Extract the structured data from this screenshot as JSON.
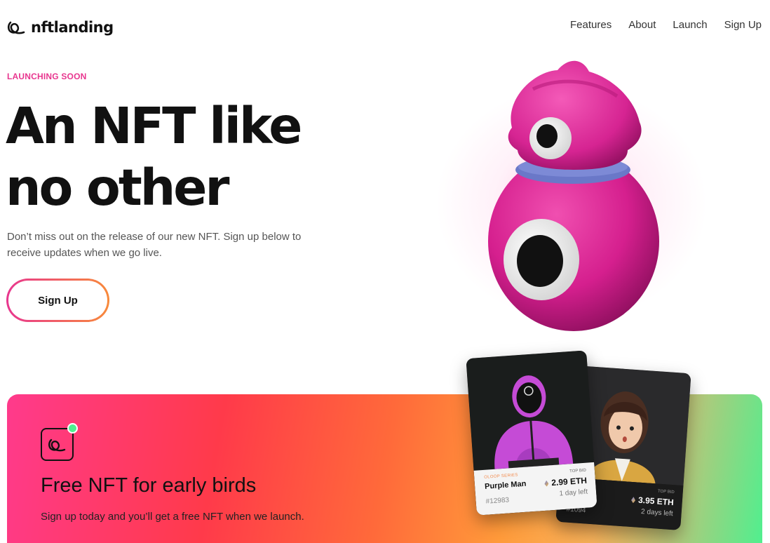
{
  "brand": {
    "name": "nftlanding"
  },
  "nav": {
    "items": [
      {
        "label": "Features"
      },
      {
        "label": "About"
      },
      {
        "label": "Launch"
      },
      {
        "label": "Sign Up"
      }
    ]
  },
  "hero": {
    "eyebrow": "LAUNCHING SOON",
    "headline_line1": "An NFT like",
    "headline_line2": "no other",
    "description": "Don’t miss out on the release of our new NFT. Sign up below to receive updates when we go live.",
    "cta_label": "Sign Up"
  },
  "banner": {
    "title": "Free NFT for early birds",
    "text": "Sign up today and you’ll get a free NFT when we launch."
  },
  "cards": [
    {
      "series": "OLOOP SERIES",
      "name": "Purple Man",
      "id": "#12983",
      "bid_label": "TOP BID",
      "price": "2.99 ETH",
      "time_left": "1 day left"
    },
    {
      "id": "#1094",
      "bid_label": "TOP BID",
      "price": "3.95 ETH",
      "time_left": "2 days left"
    }
  ],
  "colors": {
    "accent_pink": "#e8368f",
    "accent_orange": "#f88a3a",
    "accent_green": "#4ef08f"
  },
  "icons": [
    "logo-loop-icon",
    "eth-icon",
    "status-dot-icon"
  ]
}
